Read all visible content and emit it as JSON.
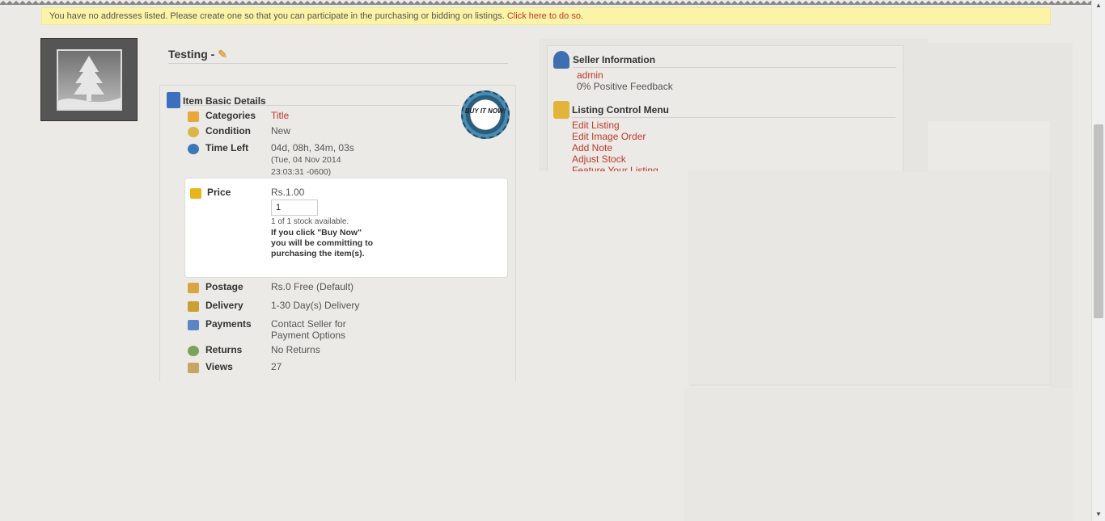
{
  "notice": {
    "text": "You have no addresses listed. Please create one so that you can participate in the purchasing or bidding on listings. ",
    "link": "Click here to do so."
  },
  "listing": {
    "title": "Testing -",
    "edit_icon": "pencil-icon"
  },
  "details": {
    "heading": "Item Basic Details",
    "badge_text": "BUY IT NOW!",
    "categories": {
      "label": "Categories",
      "value": "Title"
    },
    "condition": {
      "label": "Condition",
      "value": "New"
    },
    "time_left": {
      "label": "Time Left",
      "value": "04d, 08h, 34m, 03s",
      "date1": "(Tue, 04 Nov 2014",
      "date2": "23:03:31 -0600)"
    },
    "price": {
      "label": "Price",
      "value": "Rs.1.00",
      "quantity": "1",
      "stock": "1 of 1 stock available.",
      "warning": "If you click \"Buy Now\" you will be committing to purchasing the item(s)."
    },
    "postage": {
      "label": "Postage",
      "value": "Rs.0 Free (Default)"
    },
    "delivery": {
      "label": "Delivery",
      "value": "1-30 Day(s) Delivery"
    },
    "payments": {
      "label": "Payments",
      "value1": "Contact Seller for",
      "value2": "Payment Options"
    },
    "returns": {
      "label": "Returns",
      "value": "No Returns"
    },
    "views": {
      "label": "Views",
      "value": "27"
    }
  },
  "seller": {
    "heading": "Seller Information",
    "name": "admin",
    "feedback": "0% Positive Feedback"
  },
  "control_menu": {
    "heading": "Listing Control Menu",
    "items": [
      "Edit Listing",
      "Edit Image Order",
      "Add Note",
      "Adjust Stock",
      "Feature Your Listing"
    ]
  },
  "colors": {
    "link": "#c0392b",
    "notice_bg": "#fbf3a6",
    "page_bg": "#ebeae6"
  }
}
